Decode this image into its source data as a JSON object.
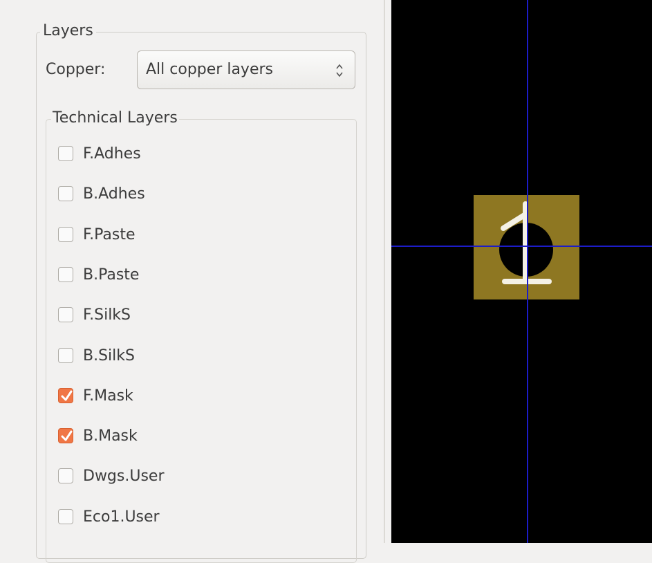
{
  "layers_panel": {
    "title": "Layers",
    "copper": {
      "label": "Copper:",
      "selected": "All copper layers"
    },
    "technical_layers": {
      "title": "Technical Layers",
      "items": [
        {
          "label": "F.Adhes",
          "checked": false
        },
        {
          "label": "B.Adhes",
          "checked": false
        },
        {
          "label": "F.Paste",
          "checked": false
        },
        {
          "label": "B.Paste",
          "checked": false
        },
        {
          "label": "F.SilkS",
          "checked": false
        },
        {
          "label": "B.SilkS",
          "checked": false
        },
        {
          "label": "F.Mask",
          "checked": true
        },
        {
          "label": "B.Mask",
          "checked": true
        },
        {
          "label": "Dwgs.User",
          "checked": false
        },
        {
          "label": "Eco1.User",
          "checked": false
        }
      ]
    }
  },
  "preview": {
    "pad_number": "1",
    "colors": {
      "background": "#000000",
      "pad": "#8e7722",
      "crosshair": "#1c1cc8",
      "pad_text": "#f4f1e6",
      "checkbox_checked": "#f07746"
    }
  }
}
